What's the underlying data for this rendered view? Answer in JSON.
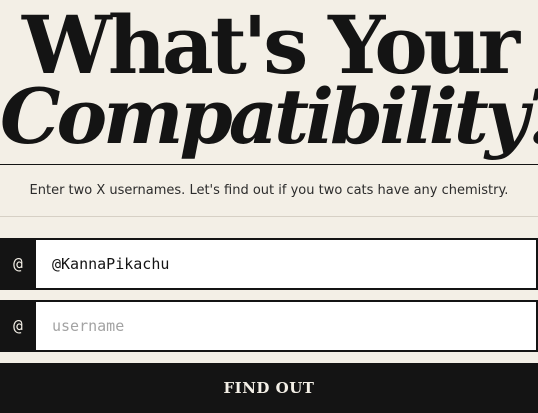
{
  "hero": {
    "title_line1": "What's Your",
    "title_line2": "Compatibility?"
  },
  "subtitle": "Enter two X usernames. Let's find out if you two cats have any chemistry.",
  "form": {
    "prefix": "@",
    "first_field": {
      "value": "@KannaPikachu",
      "placeholder": "username"
    },
    "second_field": {
      "value": "",
      "placeholder": "username"
    },
    "submit_label": "FIND OUT"
  },
  "colors": {
    "background": "#f3efe6",
    "ink": "#141414",
    "field_background": "#ffffff",
    "placeholder": "#a3a3a3"
  }
}
